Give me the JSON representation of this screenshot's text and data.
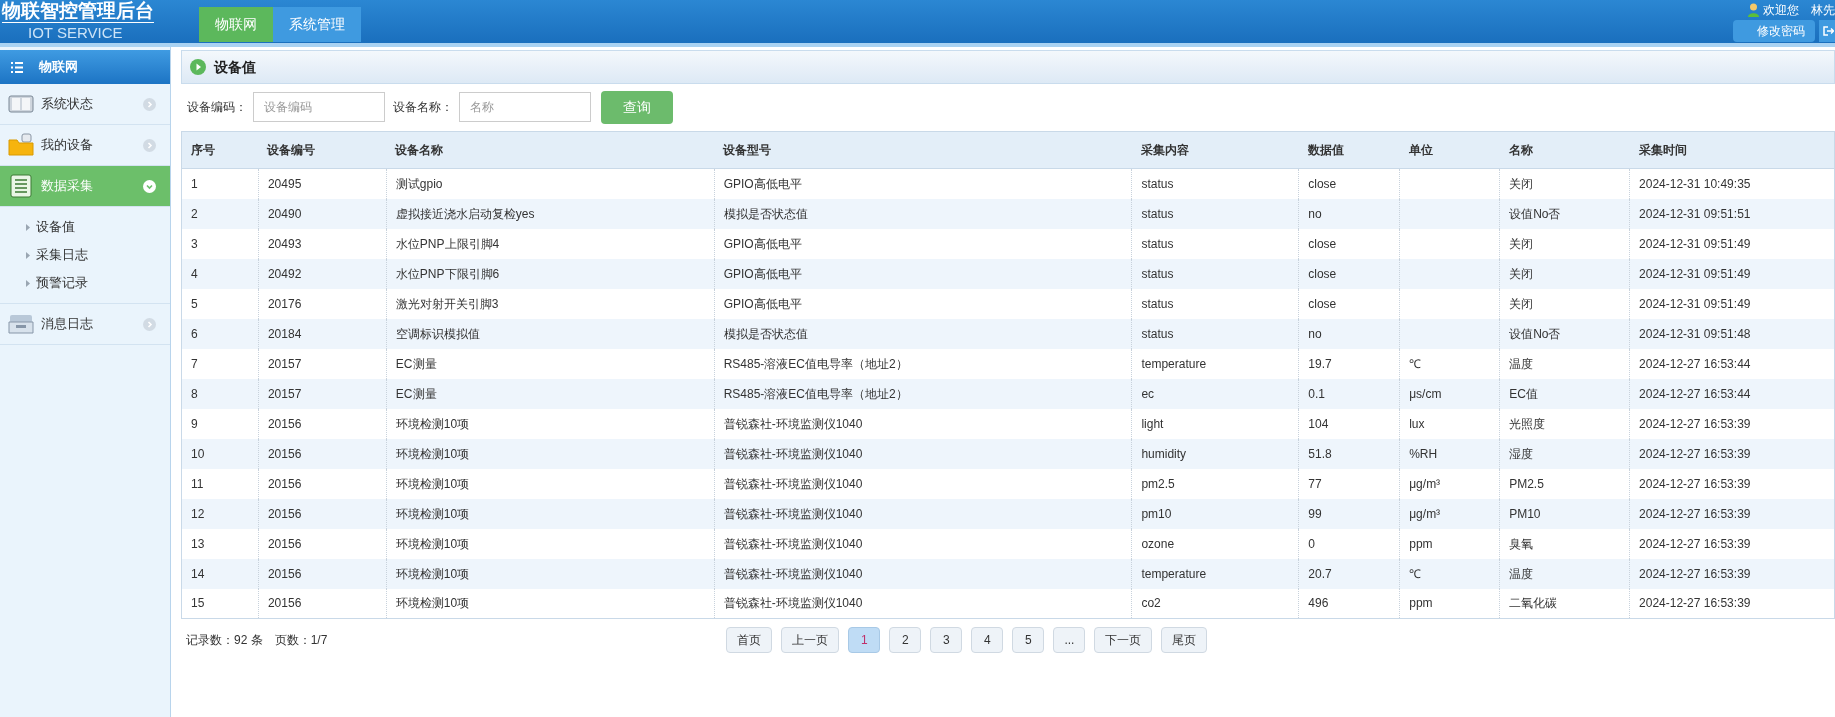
{
  "header": {
    "title": "物联智控管理后台",
    "subtitle": "IOT SERVICE",
    "nav_tabs": [
      {
        "label": "物联网",
        "selected": true
      },
      {
        "label": "系统管理",
        "selected": false
      }
    ],
    "user": {
      "greeting": "欢迎您",
      "name": "林先"
    },
    "buttons": [
      "修改密码"
    ]
  },
  "sidebar": {
    "title": "物联网",
    "items": [
      {
        "label": "系统状态",
        "selected": false,
        "expanded": false
      },
      {
        "label": "我的设备",
        "selected": false,
        "expanded": false
      },
      {
        "label": "数据采集",
        "selected": true,
        "expanded": true,
        "children": [
          {
            "label": "设备值"
          },
          {
            "label": "采集日志"
          },
          {
            "label": "预警记录"
          }
        ]
      },
      {
        "label": "消息日志",
        "selected": false,
        "expanded": false
      }
    ]
  },
  "panel": {
    "title": "设备值",
    "filters": [
      {
        "label": "设备编码：",
        "placeholder": "设备编码"
      },
      {
        "label": "设备名称：",
        "placeholder": "名称"
      }
    ],
    "search_button": "查询"
  },
  "table": {
    "columns": [
      "序号",
      "设备编号",
      "设备名称",
      "设备型号",
      "采集内容",
      "数据值",
      "单位",
      "名称",
      "采集时间"
    ],
    "rows": [
      [
        "1",
        "20495",
        "测试gpio",
        "GPIO高低电平",
        "status",
        "close",
        "",
        "关闭",
        "2024-12-31 10:49:35"
      ],
      [
        "2",
        "20490",
        "虚拟接近浇水启动复检yes",
        "模拟是否状态值",
        "status",
        "no",
        "",
        "设值No否",
        "2024-12-31 09:51:51"
      ],
      [
        "3",
        "20493",
        "水位PNP上限引脚4",
        "GPIO高低电平",
        "status",
        "close",
        "",
        "关闭",
        "2024-12-31 09:51:49"
      ],
      [
        "4",
        "20492",
        "水位PNP下限引脚6",
        "GPIO高低电平",
        "status",
        "close",
        "",
        "关闭",
        "2024-12-31 09:51:49"
      ],
      [
        "5",
        "20176",
        "激光对射开关引脚3",
        "GPIO高低电平",
        "status",
        "close",
        "",
        "关闭",
        "2024-12-31 09:51:49"
      ],
      [
        "6",
        "20184",
        "空调标识模拟值",
        "模拟是否状态值",
        "status",
        "no",
        "",
        "设值No否",
        "2024-12-31 09:51:48"
      ],
      [
        "7",
        "20157",
        "EC测量",
        "RS485-溶液EC值电导率（地址2）",
        "temperature",
        "19.7",
        "℃",
        "温度",
        "2024-12-27 16:53:44"
      ],
      [
        "8",
        "20157",
        "EC测量",
        "RS485-溶液EC值电导率（地址2）",
        "ec",
        "0.1",
        "μs/cm",
        "EC值",
        "2024-12-27 16:53:44"
      ],
      [
        "9",
        "20156",
        "环境检测10项",
        "普锐森社-环境监测仪1040",
        "light",
        "104",
        "lux",
        "光照度",
        "2024-12-27 16:53:39"
      ],
      [
        "10",
        "20156",
        "环境检测10项",
        "普锐森社-环境监测仪1040",
        "humidity",
        "51.8",
        "%RH",
        "湿度",
        "2024-12-27 16:53:39"
      ],
      [
        "11",
        "20156",
        "环境检测10项",
        "普锐森社-环境监测仪1040",
        "pm2.5",
        "77",
        "μg/m³",
        "PM2.5",
        "2024-12-27 16:53:39"
      ],
      [
        "12",
        "20156",
        "环境检测10项",
        "普锐森社-环境监测仪1040",
        "pm10",
        "99",
        "μg/m³",
        "PM10",
        "2024-12-27 16:53:39"
      ],
      [
        "13",
        "20156",
        "环境检测10项",
        "普锐森社-环境监测仪1040",
        "ozone",
        "0",
        "ppm",
        "臭氧",
        "2024-12-27 16:53:39"
      ],
      [
        "14",
        "20156",
        "环境检测10项",
        "普锐森社-环境监测仪1040",
        "temperature",
        "20.7",
        "℃",
        "温度",
        "2024-12-27 16:53:39"
      ],
      [
        "15",
        "20156",
        "环境检测10项",
        "普锐森社-环境监测仪1040",
        "co2",
        "496",
        "ppm",
        "二氧化碳",
        "2024-12-27 16:53:39"
      ]
    ]
  },
  "pagination": {
    "record_count": "记录数：92 条",
    "page_count": "页数：1/7",
    "pages": [
      {
        "label": "首页",
        "selected": false
      },
      {
        "label": "上一页",
        "selected": false
      },
      {
        "label": "1",
        "selected": true
      },
      {
        "label": "2",
        "selected": false
      },
      {
        "label": "3",
        "selected": false
      },
      {
        "label": "4",
        "selected": false
      },
      {
        "label": "5",
        "selected": false
      },
      {
        "label": "...",
        "selected": false
      },
      {
        "label": "下一页",
        "selected": false
      },
      {
        "label": "尾页",
        "selected": false
      }
    ]
  }
}
